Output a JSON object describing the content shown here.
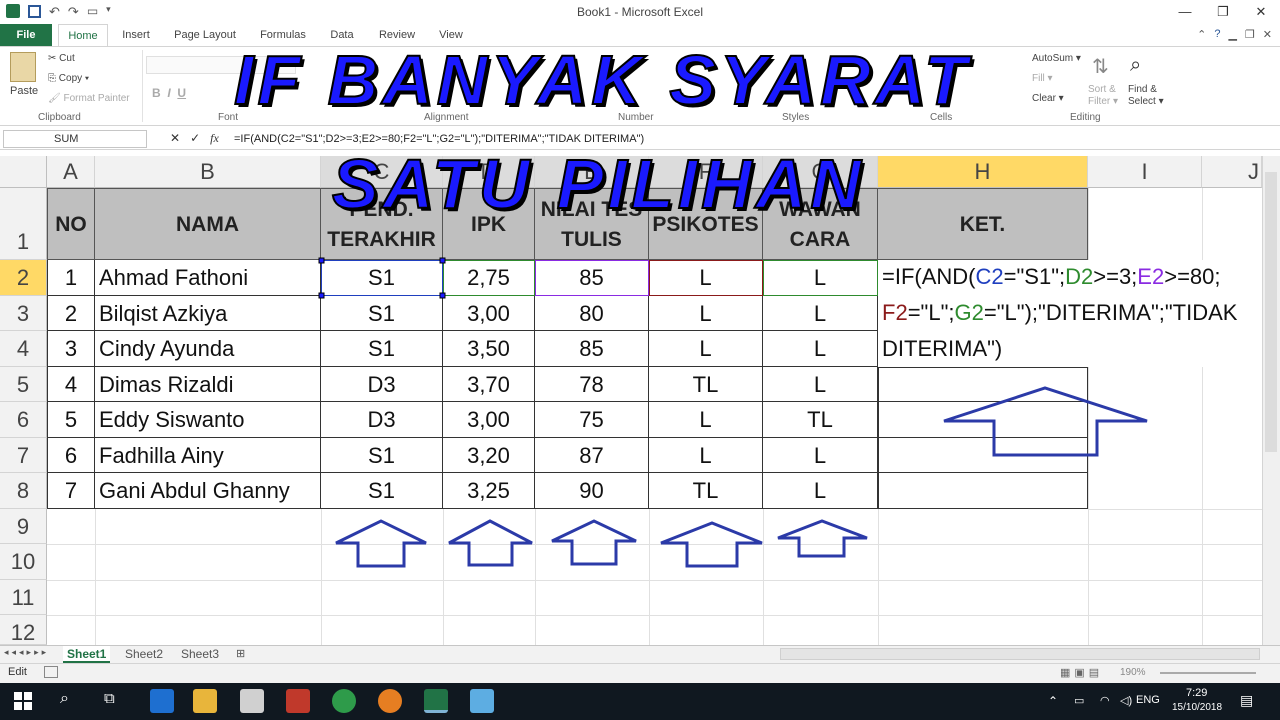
{
  "window": {
    "title": "Book1 - Microsoft Excel"
  },
  "ribbon_tabs": [
    "File",
    "Home",
    "Insert",
    "Page Layout",
    "Formulas",
    "Data",
    "Review",
    "View"
  ],
  "clipboard": {
    "paste": "Paste",
    "cut": "Cut",
    "copy": "Copy ▾",
    "format_painter": "Format Painter",
    "group": "Clipboard"
  },
  "ribbon_groups": {
    "font": "Font",
    "alignment": "Alignment",
    "number": "Number",
    "styles": "Styles",
    "cells": "Cells",
    "editing": "Editing"
  },
  "editing": {
    "autosum": "AutoSum ▾",
    "fill": "Fill ▾",
    "clear": "Clear ▾",
    "sort": "Sort & Filter ▾",
    "find": "Find & Select ▾"
  },
  "formula_bar": {
    "name_box": "SUM",
    "fx": "fx",
    "formula": "=IF(AND(C2=\"S1\";D2>=3;E2>=80;F2=\"L\";G2=\"L\");\"DITERIMA\";\"TIDAK DITERIMA\")"
  },
  "columns": [
    "A",
    "B",
    "C",
    "D",
    "E",
    "F",
    "G",
    "H",
    "I",
    "J"
  ],
  "rows": [
    "1",
    "2",
    "3",
    "4",
    "5",
    "6",
    "7",
    "8",
    "9",
    "10",
    "11",
    "12"
  ],
  "headers": {
    "no": "NO",
    "nama": "NAMA",
    "pend": [
      "PEND.",
      "TERAKHIR"
    ],
    "ipk": "IPK",
    "nilai": [
      "NILAI TES",
      "TULIS"
    ],
    "psikotes": "PSIKOTES",
    "wawancara": [
      "WAWAN",
      "CARA"
    ],
    "ket": "KET."
  },
  "data": [
    [
      "1",
      "Ahmad Fathoni",
      "S1",
      "2,75",
      "85",
      "L",
      "L"
    ],
    [
      "2",
      "Bilqist Azkiya",
      "S1",
      "3,00",
      "80",
      "L",
      "L"
    ],
    [
      "3",
      "Cindy Ayunda",
      "S1",
      "3,50",
      "85",
      "L",
      "L"
    ],
    [
      "4",
      "Dimas Rizaldi",
      "D3",
      "3,70",
      "78",
      "TL",
      "L"
    ],
    [
      "5",
      "Eddy Siswanto",
      "D3",
      "3,00",
      "75",
      "L",
      "TL"
    ],
    [
      "6",
      "Fadhilla Ainy",
      "S1",
      "3,20",
      "87",
      "L",
      "L"
    ],
    [
      "7",
      "Gani Abdul Ghanny",
      "S1",
      "3,25",
      "90",
      "TL",
      "L"
    ]
  ],
  "cell_formula": {
    "p1": "=IF(AND(",
    "c2": "C2",
    "p2": "=\"S1\";",
    "d2": "D2",
    "p3": ">=3;",
    "e2": "E2",
    "p4": ">=80;",
    "f2": "F2",
    "p5": "=\"L\";",
    "g2": "G2",
    "p6": "=\"L\");\"DITERIMA\";\"TIDAK",
    "p7": "DITERIMA\")",
    "colors": {
      "c2": "#1f3fbf",
      "d2": "#2e8b2e",
      "e2": "#8a2be2",
      "f2": "#8b1a1a",
      "g2": "#2e8b2e"
    }
  },
  "banner": {
    "line1": "IF BANYAK SYARAT",
    "line2": "SATU PILIHAN"
  },
  "sheets": [
    "Sheet1",
    "Sheet2",
    "Sheet3"
  ],
  "status": {
    "mode": "Edit",
    "zoom": "190%"
  },
  "taskbar": {
    "lang": "ENG",
    "time": "7:29",
    "date": "15/10/2018"
  }
}
